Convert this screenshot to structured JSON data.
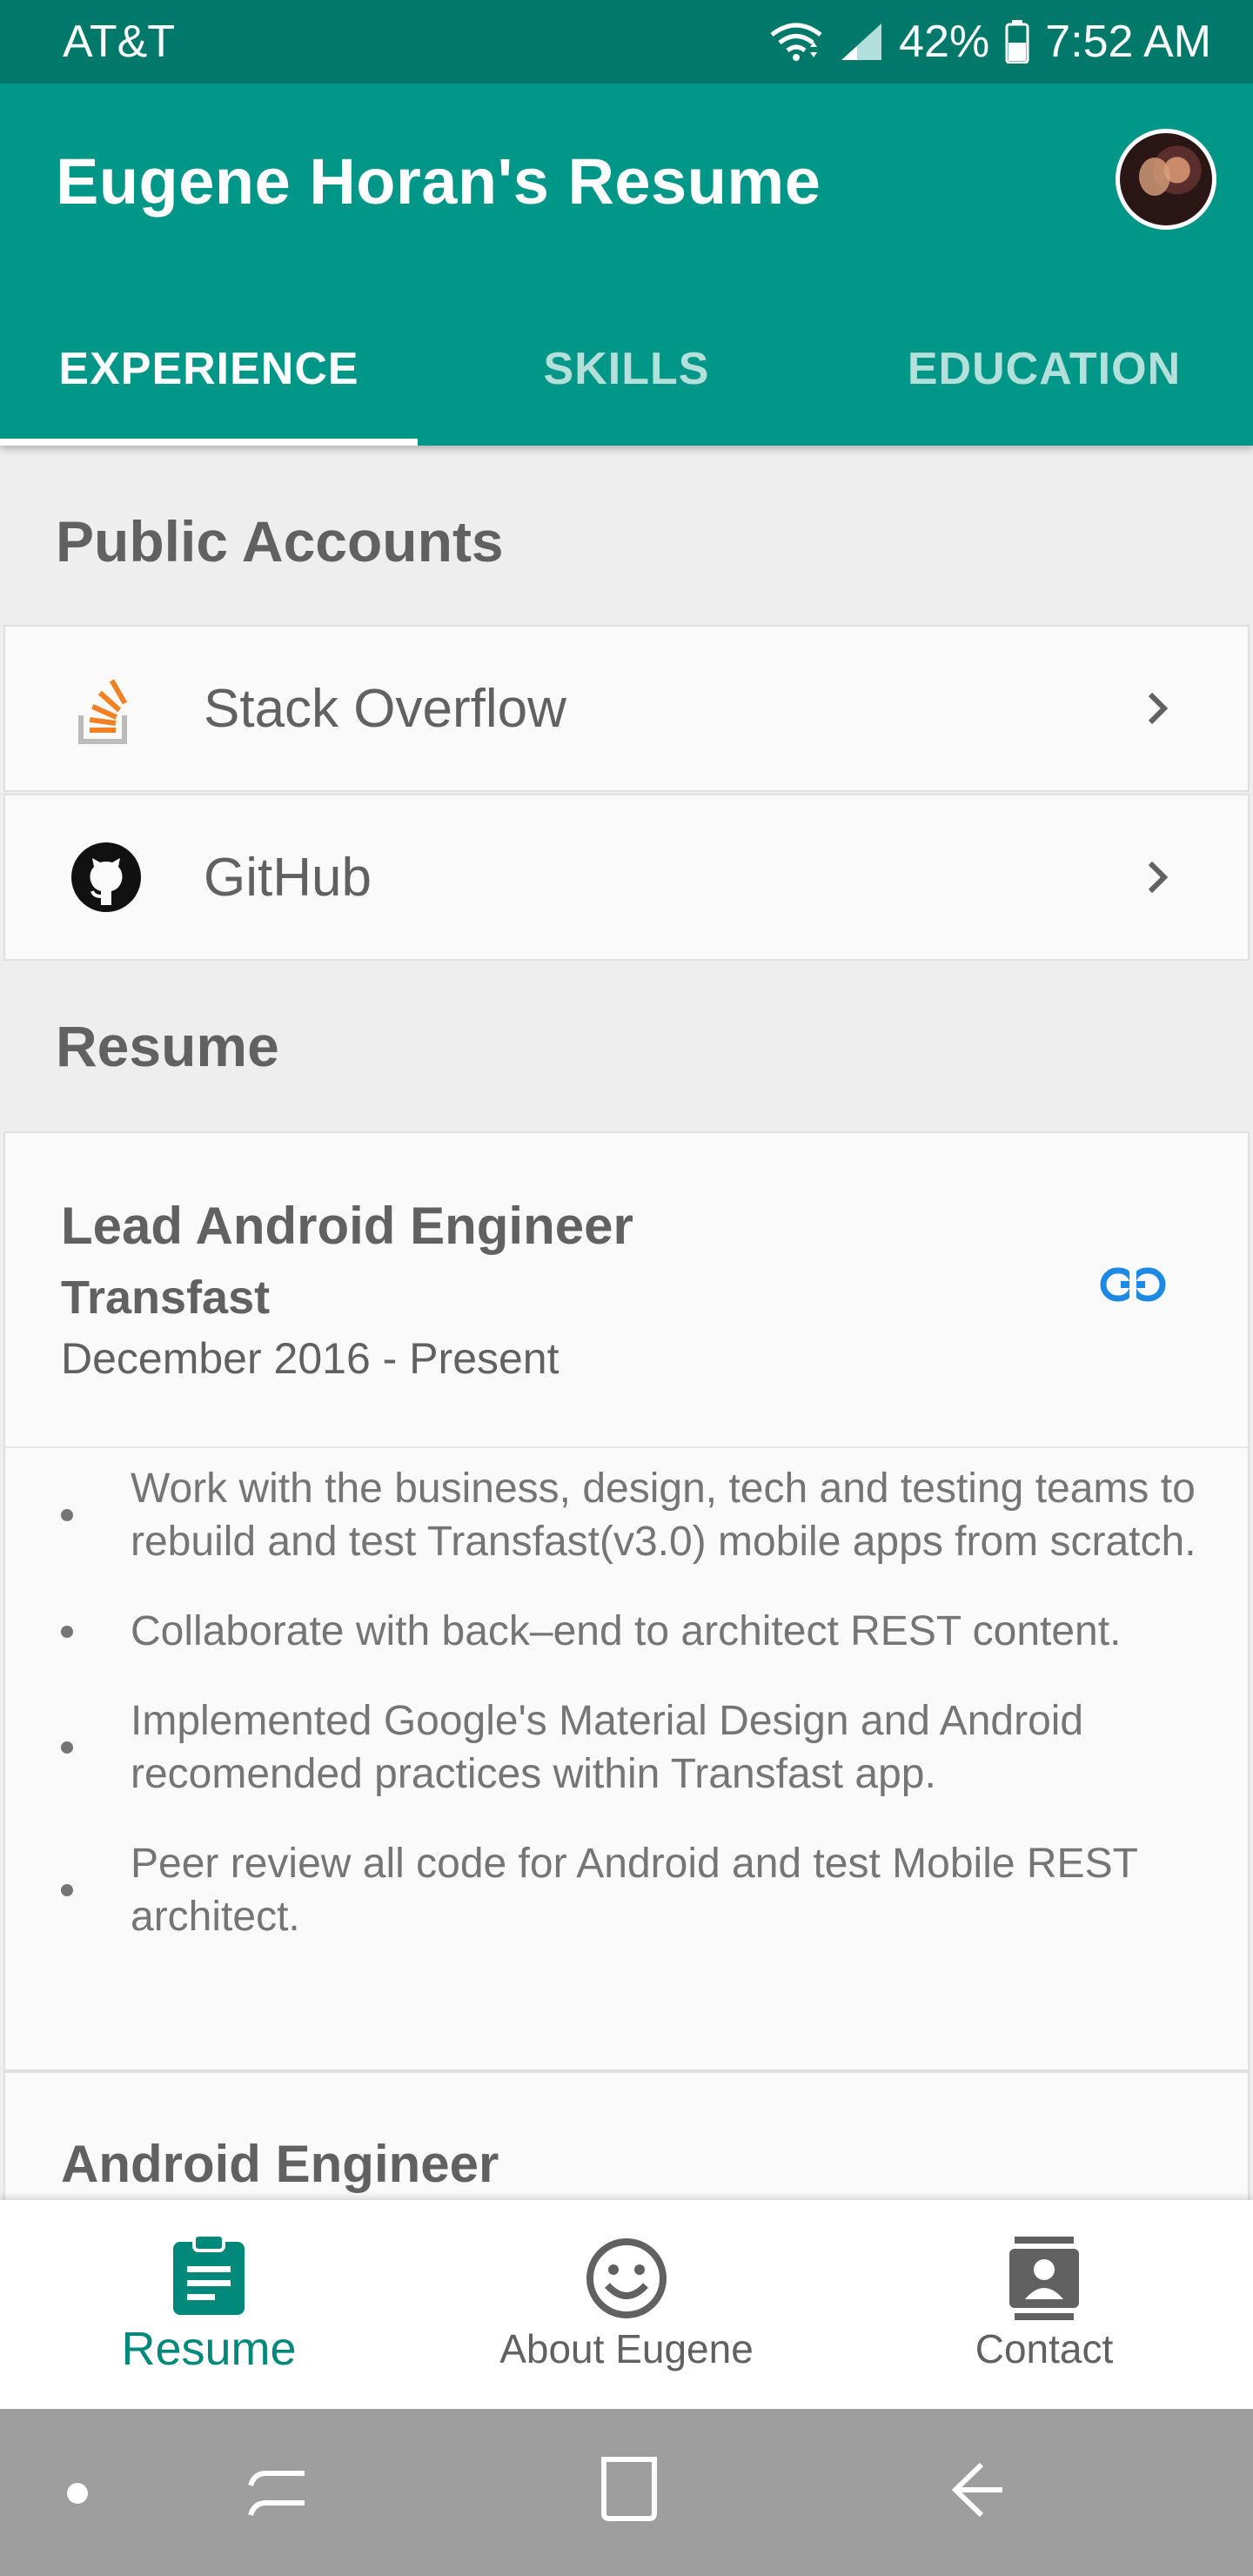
{
  "status_bar": {
    "carrier": "AT&T",
    "battery": "42%",
    "time": "7:52 AM",
    "icons": [
      "wifi-icon",
      "signal-icon",
      "battery-icon"
    ]
  },
  "app_bar": {
    "title": "Eugene Horan's Resume",
    "avatar_icon": "profile-photo"
  },
  "tabs": [
    {
      "label": "EXPERIENCE",
      "active": true
    },
    {
      "label": "SKILLS",
      "active": false
    },
    {
      "label": "EDUCATION",
      "active": false
    }
  ],
  "public_accounts": {
    "header": "Public Accounts",
    "items": [
      {
        "label": "Stack Overflow",
        "icon": "stackoverflow-icon"
      },
      {
        "label": "GitHub",
        "icon": "github-icon"
      }
    ]
  },
  "resume": {
    "header": "Resume",
    "jobs": [
      {
        "title": "Lead Android Engineer",
        "company": "Transfast",
        "dates": "December 2016 - Present",
        "bullets": [
          "Work with the business, design, tech and testing teams to rebuild and test Transfast(v3.0) mobile apps from scratch.",
          "Collaborate with back–end to architect REST content.",
          "Implemented Google's Material Design and Android recomended practices within Transfast app.",
          "Peer review all code for Android and test Mobile REST architect."
        ]
      },
      {
        "title": "Android Engineer"
      }
    ]
  },
  "bottom_nav": [
    {
      "label": "Resume",
      "icon": "clipboard-icon",
      "active": true
    },
    {
      "label": "About Eugene",
      "icon": "smiley-icon",
      "active": false
    },
    {
      "label": "Contact",
      "icon": "contact-card-icon",
      "active": false
    }
  ],
  "colors": {
    "primary": "#009688",
    "primary_dark": "#00796b",
    "accent_link": "#1e88e5",
    "stackoverflow_orange": "#f48024"
  }
}
